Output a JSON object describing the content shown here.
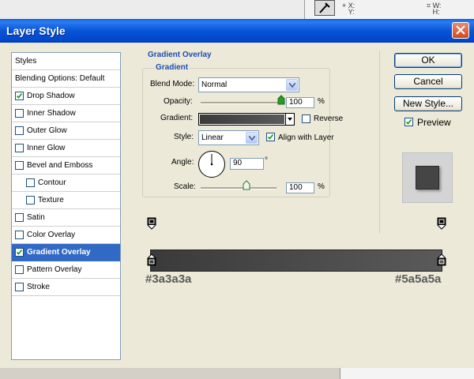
{
  "background": {
    "xy_label": "X:\nY:",
    "wh_label": "W:\nH:"
  },
  "dialog": {
    "title": "Layer Style"
  },
  "styles_list": {
    "items": [
      {
        "label": "Styles",
        "checkbox": false,
        "checked": false,
        "selected": false
      },
      {
        "label": "Blending Options: Default",
        "checkbox": false,
        "checked": false,
        "selected": false
      },
      {
        "label": "Drop Shadow",
        "checkbox": true,
        "checked": true,
        "selected": false
      },
      {
        "label": "Inner Shadow",
        "checkbox": true,
        "checked": false,
        "selected": false
      },
      {
        "label": "Outer Glow",
        "checkbox": true,
        "checked": false,
        "selected": false
      },
      {
        "label": "Inner Glow",
        "checkbox": true,
        "checked": false,
        "selected": false
      },
      {
        "label": "Bevel and Emboss",
        "checkbox": true,
        "checked": false,
        "selected": false
      },
      {
        "label": "Contour",
        "checkbox": true,
        "checked": false,
        "selected": false
      },
      {
        "label": "Texture",
        "checkbox": true,
        "checked": false,
        "selected": false
      },
      {
        "label": "Satin",
        "checkbox": true,
        "checked": false,
        "selected": false
      },
      {
        "label": "Color Overlay",
        "checkbox": true,
        "checked": false,
        "selected": false
      },
      {
        "label": "Gradient Overlay",
        "checkbox": true,
        "checked": true,
        "selected": true
      },
      {
        "label": "Pattern Overlay",
        "checkbox": true,
        "checked": false,
        "selected": false
      },
      {
        "label": "Stroke",
        "checkbox": true,
        "checked": false,
        "selected": false
      }
    ]
  },
  "gradient_overlay": {
    "section_title": "Gradient Overlay",
    "group_title": "Gradient",
    "blend_mode_label": "Blend Mode:",
    "blend_mode_value": "Normal",
    "opacity_label": "Opacity:",
    "opacity_value": "100",
    "opacity_unit": "%",
    "opacity_fraction": 1.0,
    "gradient_label": "Gradient:",
    "reverse_label": "Reverse",
    "reverse_checked": false,
    "style_label": "Style:",
    "style_value": "Linear",
    "align_label": "Align with Layer",
    "align_checked": true,
    "angle_label": "Angle:",
    "angle_value": "90",
    "angle_unit": "°",
    "scale_label": "Scale:",
    "scale_value": "100",
    "scale_unit": "%",
    "scale_fraction": 0.6
  },
  "buttons": {
    "ok": "OK",
    "cancel": "Cancel",
    "new_style": "New Style...",
    "preview_label": "Preview",
    "preview_checked": true
  },
  "gradient_editor": {
    "left_hex": "#3a3a3a",
    "right_hex": "#5a5a5a"
  },
  "colors": {
    "title_bar": "#0055e5",
    "selection": "#316ac5",
    "legend_text": "#1f4eb4",
    "gradient_start": "#3a3a3a",
    "gradient_end": "#5a5a5a"
  }
}
